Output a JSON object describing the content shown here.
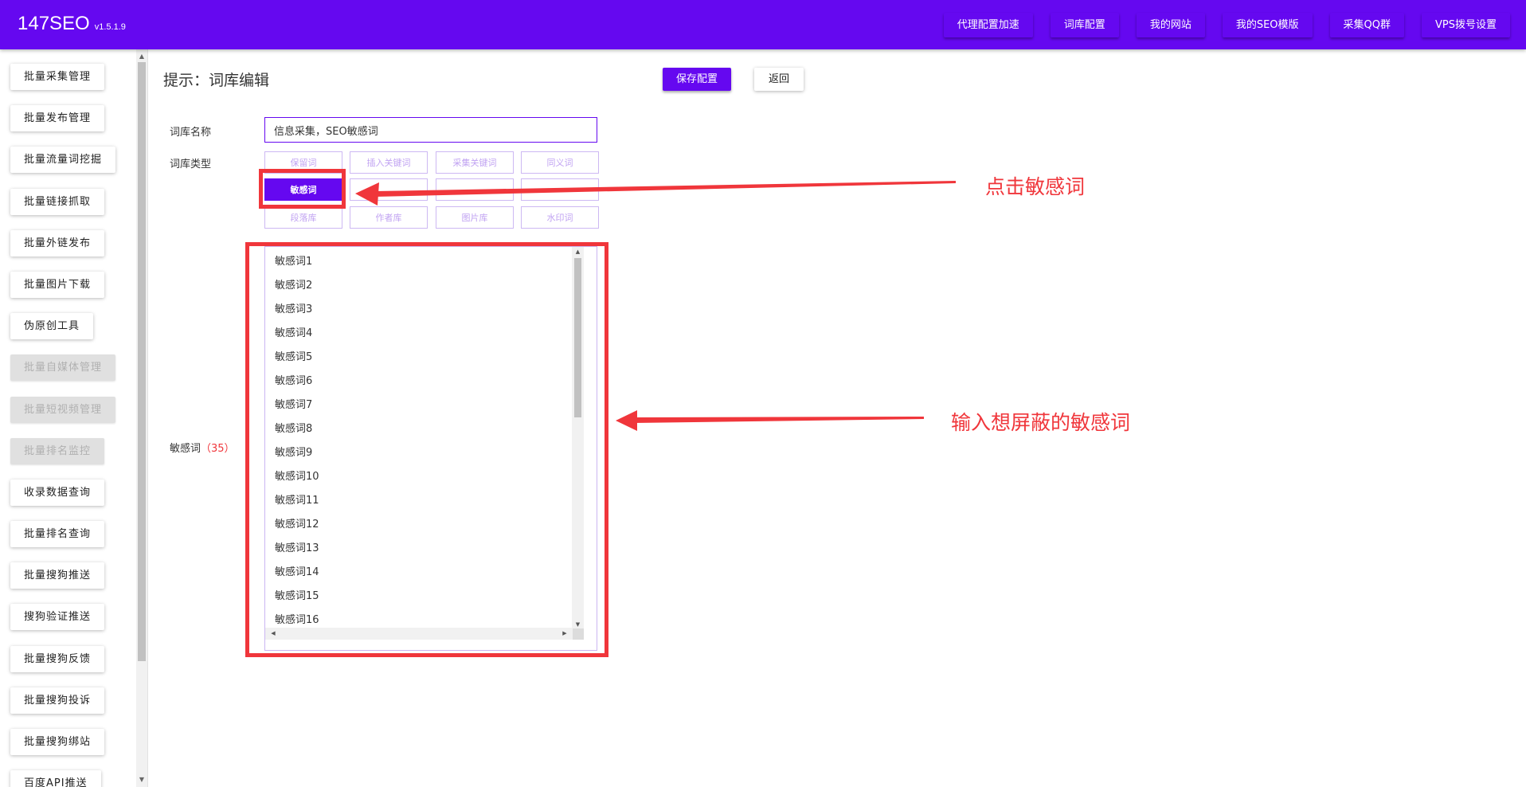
{
  "header": {
    "brand": "147SEO",
    "version": "v1.5.1.9",
    "nav": [
      "代理配置加速",
      "词库配置",
      "我的网站",
      "我的SEO模版",
      "采集QQ群",
      "VPS拨号设置"
    ]
  },
  "sidebar": {
    "items": [
      {
        "label": "批量采集管理",
        "disabled": false
      },
      {
        "label": "批量发布管理",
        "disabled": false
      },
      {
        "label": "批量流量词挖掘",
        "disabled": false
      },
      {
        "label": "批量链接抓取",
        "disabled": false
      },
      {
        "label": "批量外链发布",
        "disabled": false
      },
      {
        "label": "批量图片下载",
        "disabled": false
      },
      {
        "label": "伪原创工具",
        "disabled": false
      },
      {
        "label": "批量自媒体管理",
        "disabled": true
      },
      {
        "label": "批量短视频管理",
        "disabled": true
      },
      {
        "label": "批量排名监控",
        "disabled": true
      },
      {
        "label": "收录数据查询",
        "disabled": false
      },
      {
        "label": "批量排名查询",
        "disabled": false
      },
      {
        "label": "批量搜狗推送",
        "disabled": false
      },
      {
        "label": "搜狗验证推送",
        "disabled": false
      },
      {
        "label": "批量搜狗反馈",
        "disabled": false
      },
      {
        "label": "批量搜狗投诉",
        "disabled": false
      },
      {
        "label": "批量搜狗绑站",
        "disabled": false
      },
      {
        "label": "百度API推送",
        "disabled": false
      }
    ]
  },
  "main": {
    "hint": "提示：词库编辑",
    "save_label": "保存配置",
    "back_label": "返回",
    "name_label": "词库名称",
    "name_value": "信息采集，SEO敏感词",
    "type_label": "词库类型",
    "types": [
      "保留词",
      "插入关键词",
      "采集关键词",
      "同义词",
      "敏感词",
      "",
      "",
      "",
      "段落库",
      "作者库",
      "图片库",
      "水印词"
    ],
    "active_type": "敏感词",
    "words_label": "敏感词",
    "words_count": "（35）",
    "words": [
      "敏感词1",
      "敏感词2",
      "敏感词3",
      "敏感词4",
      "敏感词5",
      "敏感词6",
      "敏感词7",
      "敏感词8",
      "敏感词9",
      "敏感词10",
      "敏感词11",
      "敏感词12",
      "敏感词13",
      "敏感词14",
      "敏感词15",
      "敏感词16"
    ]
  },
  "annotations": {
    "click_hint": "点击敏感词",
    "input_hint": "输入想屏蔽的敏感词",
    "color": "#f0363b"
  },
  "theme": {
    "primary": "#6508f0"
  }
}
